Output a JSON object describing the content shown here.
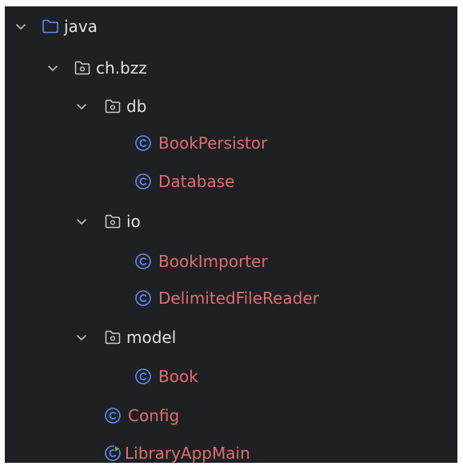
{
  "tree": {
    "root": {
      "label": "java",
      "icon": "folder-icon",
      "expanded": true
    },
    "package": {
      "label": "ch.bzz",
      "icon": "package-icon",
      "expanded": true
    },
    "db": {
      "label": "db",
      "icon": "package-icon",
      "expanded": true,
      "classes": [
        {
          "label": "BookPersistor",
          "icon": "class-icon"
        },
        {
          "label": "Database",
          "icon": "class-icon"
        }
      ]
    },
    "io": {
      "label": "io",
      "icon": "package-icon",
      "expanded": true,
      "classes": [
        {
          "label": "BookImporter",
          "icon": "class-icon"
        },
        {
          "label": "DelimitedFileReader",
          "icon": "class-icon"
        }
      ]
    },
    "model": {
      "label": "model",
      "icon": "package-icon",
      "expanded": true,
      "classes": [
        {
          "label": "Book",
          "icon": "class-icon"
        }
      ]
    },
    "config": {
      "label": "Config",
      "icon": "class-icon"
    },
    "main": {
      "label": "LibraryAppMain",
      "icon": "runnable-class-icon"
    }
  },
  "colors": {
    "background": "#1f2023",
    "text": "#dfe1e5",
    "class_text": "#e06c6c",
    "folder_icon": "#5b8df5",
    "class_icon": "#5b8df5",
    "run_badge": "#5fb865"
  }
}
